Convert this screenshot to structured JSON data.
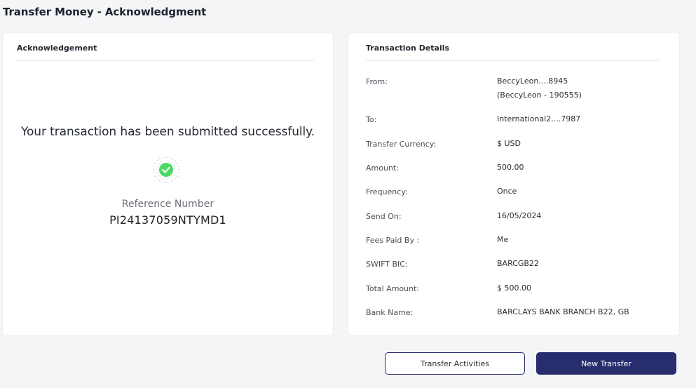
{
  "page": {
    "title": "Transfer Money - Acknowledgment"
  },
  "acknowledgement": {
    "header": "Acknowledgement",
    "message": "Your transaction has been submitted successfully.",
    "reference_label": "Reference Number",
    "reference_value": "PI24137059NTYMD1",
    "status_icon": "success-check-icon",
    "accent_color": "#4cd964"
  },
  "details": {
    "header": "Transaction Details",
    "rows": [
      {
        "label": "From:",
        "value": "BeccyLeon....8945",
        "value2": "(BeccyLeon - 190555)"
      },
      {
        "label": "To:",
        "value": "International2....7987"
      },
      {
        "label": "Transfer Currency:",
        "value": "$ USD"
      },
      {
        "label": "Amount:",
        "value": "500.00"
      },
      {
        "label": "Frequency:",
        "value": "Once"
      },
      {
        "label": "Send On:",
        "value": "16/05/2024"
      },
      {
        "label": "Fees Paid By :",
        "value": "Me"
      },
      {
        "label": "SWIFT BIC:",
        "value": "BARCGB22"
      },
      {
        "label": "Total Amount:",
        "value": "$ 500.00"
      },
      {
        "label": "Bank Name:",
        "value": "BARCLAYS BANK BRANCH B22, GB"
      }
    ]
  },
  "actions": {
    "transfer_activities_label": "Transfer Activities",
    "new_transfer_label": "New Transfer",
    "primary_color": "#272d6d"
  }
}
